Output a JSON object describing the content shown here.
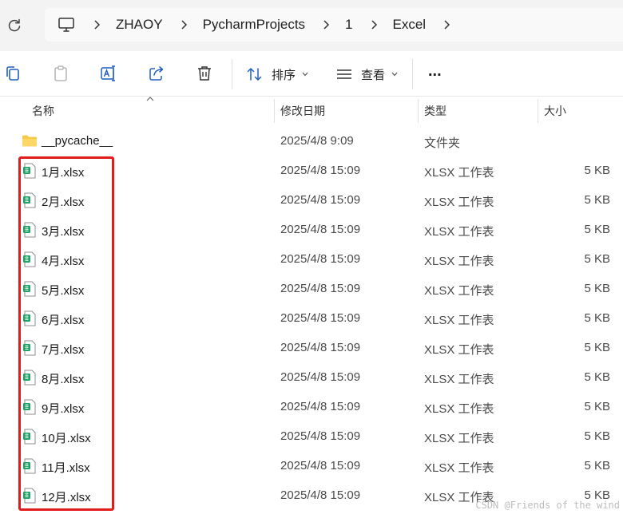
{
  "breadcrumb": [
    "ZHAOY",
    "PycharmProjects",
    "1",
    "Excel"
  ],
  "toolbar": {
    "sort_label": "排序",
    "view_label": "查看",
    "more_label": "..."
  },
  "columns": {
    "name": "名称",
    "date": "修改日期",
    "type": "类型",
    "size": "大小"
  },
  "files": [
    {
      "name": "__pycache__",
      "date": "2025/4/8 9:09",
      "type": "文件夹",
      "size": "",
      "icon": "folder-icon"
    },
    {
      "name": "1月.xlsx",
      "date": "2025/4/8 15:09",
      "type": "XLSX 工作表",
      "size": "5 KB",
      "icon": "xlsx-file-icon"
    },
    {
      "name": "2月.xlsx",
      "date": "2025/4/8 15:09",
      "type": "XLSX 工作表",
      "size": "5 KB",
      "icon": "xlsx-file-icon"
    },
    {
      "name": "3月.xlsx",
      "date": "2025/4/8 15:09",
      "type": "XLSX 工作表",
      "size": "5 KB",
      "icon": "xlsx-file-icon"
    },
    {
      "name": "4月.xlsx",
      "date": "2025/4/8 15:09",
      "type": "XLSX 工作表",
      "size": "5 KB",
      "icon": "xlsx-file-icon"
    },
    {
      "name": "5月.xlsx",
      "date": "2025/4/8 15:09",
      "type": "XLSX 工作表",
      "size": "5 KB",
      "icon": "xlsx-file-icon"
    },
    {
      "name": "6月.xlsx",
      "date": "2025/4/8 15:09",
      "type": "XLSX 工作表",
      "size": "5 KB",
      "icon": "xlsx-file-icon"
    },
    {
      "name": "7月.xlsx",
      "date": "2025/4/8 15:09",
      "type": "XLSX 工作表",
      "size": "5 KB",
      "icon": "xlsx-file-icon"
    },
    {
      "name": "8月.xlsx",
      "date": "2025/4/8 15:09",
      "type": "XLSX 工作表",
      "size": "5 KB",
      "icon": "xlsx-file-icon"
    },
    {
      "name": "9月.xlsx",
      "date": "2025/4/8 15:09",
      "type": "XLSX 工作表",
      "size": "5 KB",
      "icon": "xlsx-file-icon"
    },
    {
      "name": "10月.xlsx",
      "date": "2025/4/8 15:09",
      "type": "XLSX 工作表",
      "size": "5 KB",
      "icon": "xlsx-file-icon"
    },
    {
      "name": "11月.xlsx",
      "date": "2025/4/8 15:09",
      "type": "XLSX 工作表",
      "size": "5 KB",
      "icon": "xlsx-file-icon"
    },
    {
      "name": "12月.xlsx",
      "date": "2025/4/8 15:09",
      "type": "XLSX 工作表",
      "size": "5 KB",
      "icon": "xlsx-file-icon"
    }
  ],
  "watermark": "CSDN @Friends of the wind",
  "colors": {
    "highlight": "#e21b1b",
    "excel_green": "#21a366",
    "folder_yellow": "#f7c948"
  }
}
